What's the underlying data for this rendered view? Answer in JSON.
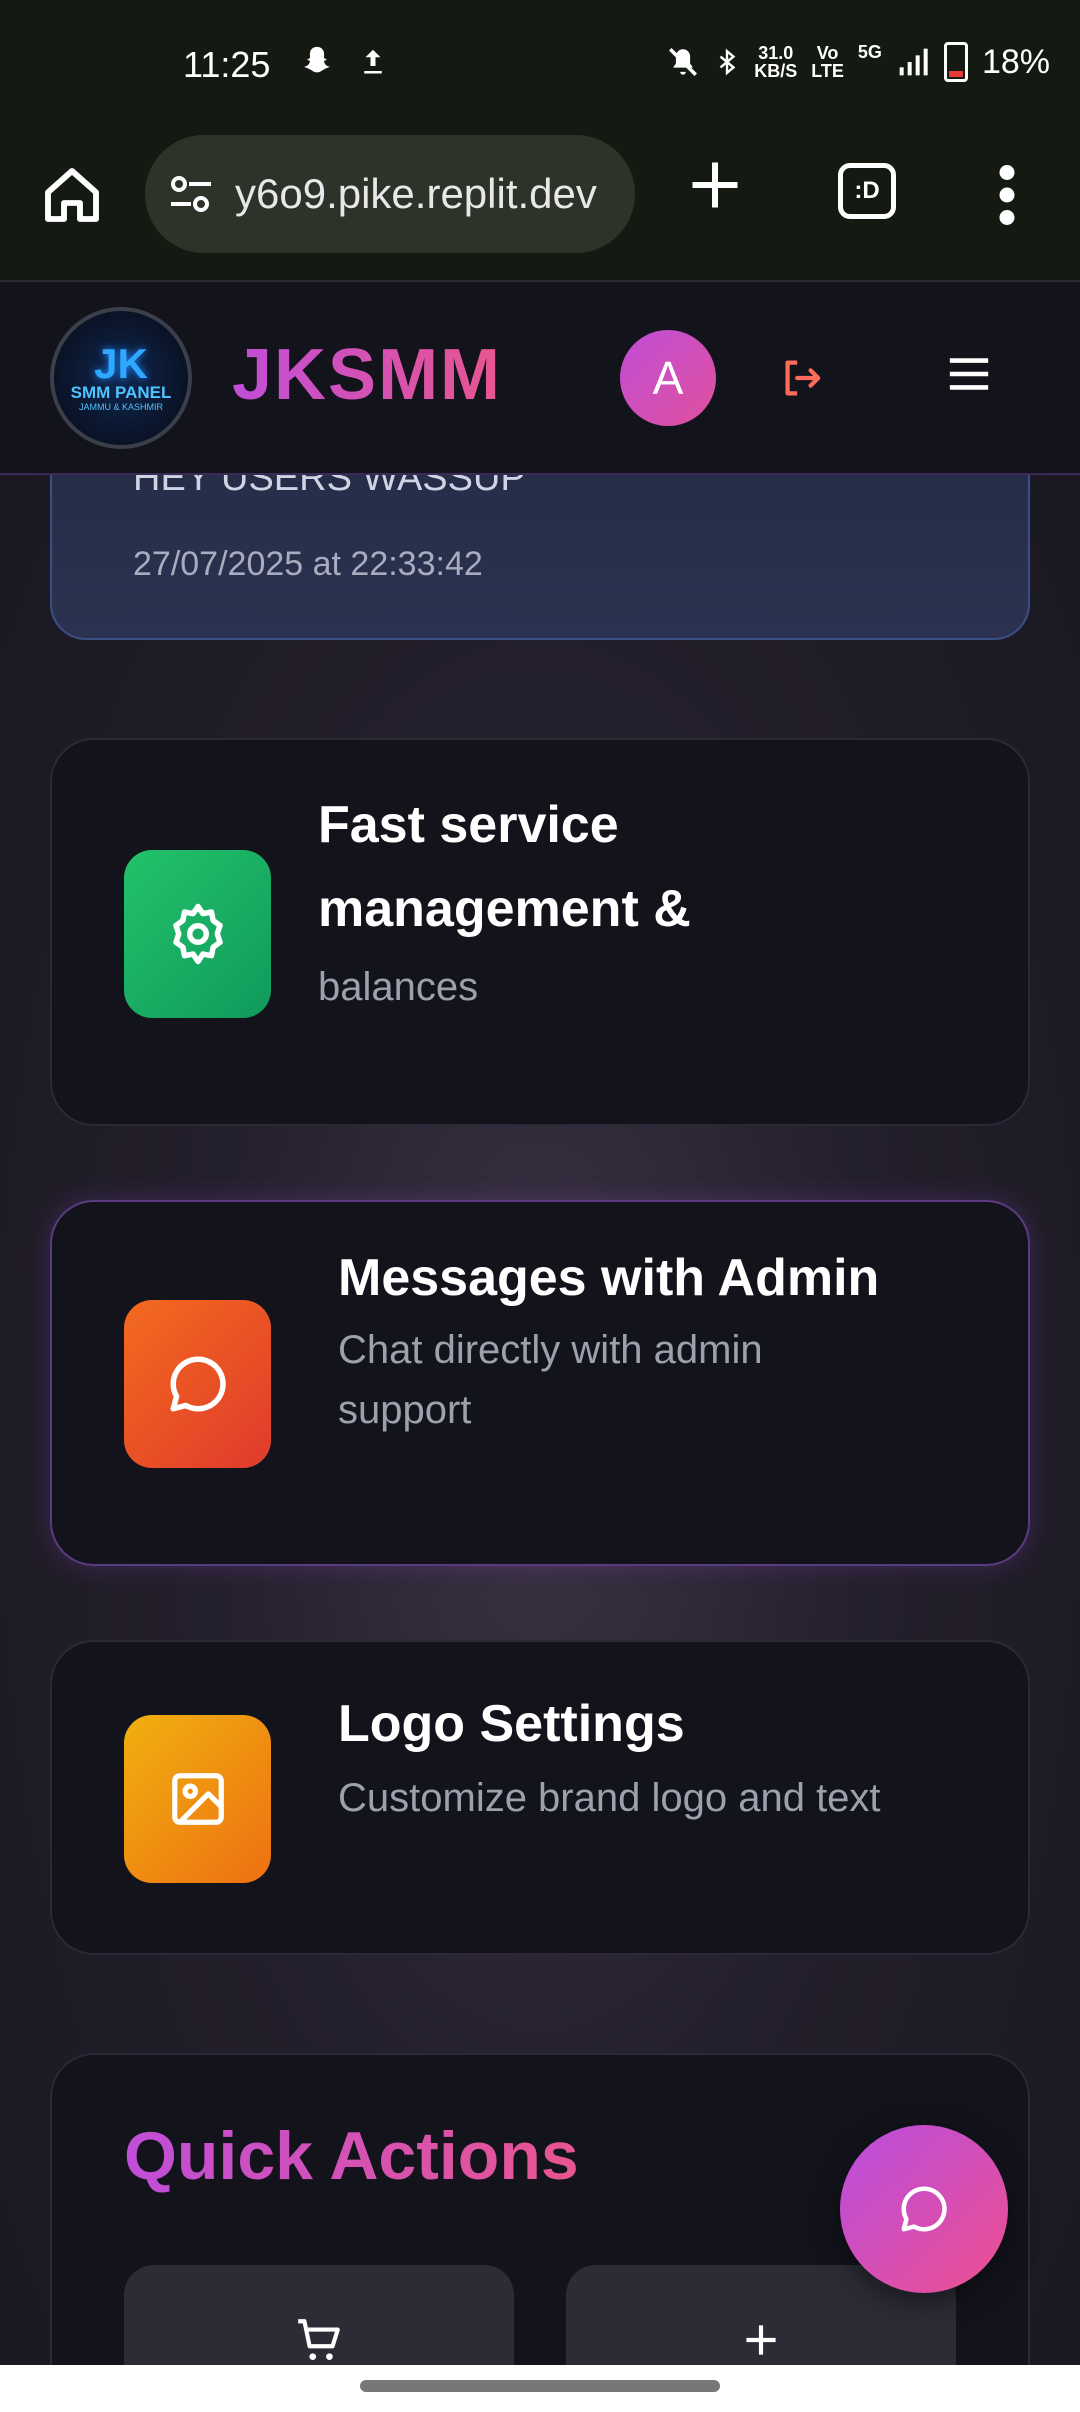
{
  "status_bar": {
    "time": "11:25",
    "left_icons": [
      "snapchat-icon",
      "upload-icon"
    ],
    "net_speed_value": "31.0",
    "net_speed_unit": "KB/S",
    "volte_top": "Vo",
    "volte_bottom": "LTE",
    "network": "5G",
    "battery": "18%",
    "icons": [
      "mute-icon",
      "bluetooth-icon",
      "signal-icon",
      "battery-icon"
    ]
  },
  "browser": {
    "url": "y6o9.pike.replit.dev",
    "tabs_label": ":D"
  },
  "app_header": {
    "logo_line1": "JK",
    "logo_line2": "SMM PANEL",
    "logo_line3": "JAMMU & KASHMIR",
    "brand": "JKSMM",
    "avatar_letter": "A"
  },
  "notice": {
    "message": "HEY USERS WASSUP",
    "timestamp": "27/07/2025 at 22:33:42"
  },
  "cards": [
    {
      "title_line1": "Fast service",
      "title_line2": "management &",
      "desc": "balances",
      "color": "#1fb86a"
    },
    {
      "title": "Messages with Admin",
      "desc_line1": "Chat directly with admin",
      "desc_line2": "support",
      "color": "#ef5a23"
    },
    {
      "title": "Logo Settings",
      "desc": "Customize brand logo and text",
      "color": "#f0a012"
    }
  ],
  "quick_actions": {
    "title": "Quick Actions",
    "buttons": [
      "cart-icon",
      "plus-icon"
    ]
  },
  "colors": {
    "accent_start": "#c04ed8",
    "accent_end": "#e85590"
  }
}
